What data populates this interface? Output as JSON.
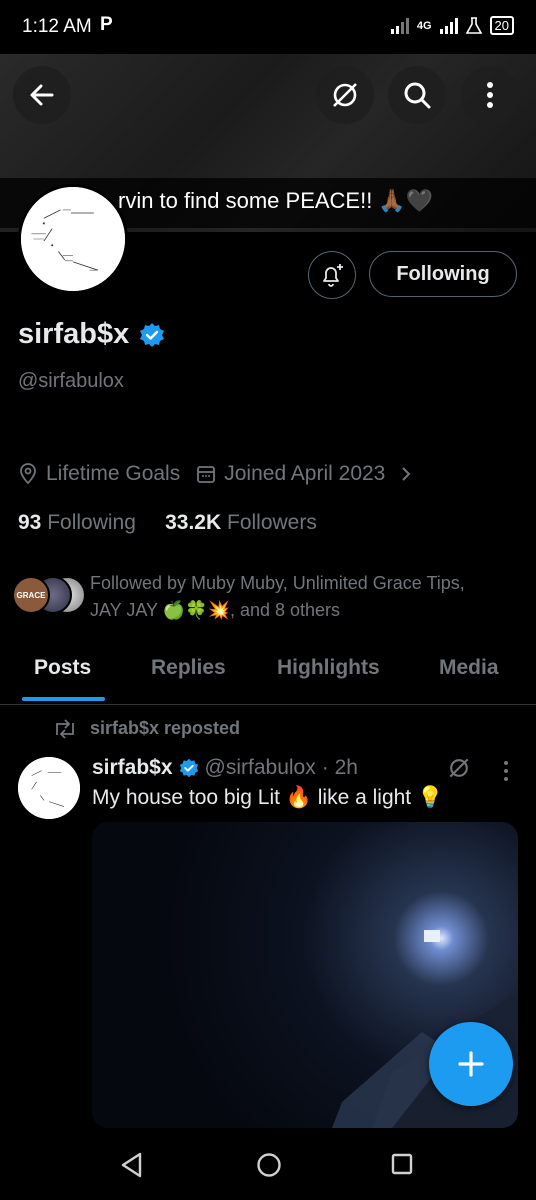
{
  "status_bar": {
    "time": "1:12 AM",
    "carrier_icon": "P",
    "network": "4G",
    "battery": "20"
  },
  "banner": {
    "caption": "rvin to find some PEACE!! 🙏🏾🖤"
  },
  "profile": {
    "following_button": "Following",
    "display_name": "sirfab$x",
    "handle": "@sirfabulox",
    "location": "Lifetime Goals",
    "joined": "Joined April 2023",
    "following_count": "93",
    "following_label": "Following",
    "followers_count": "33.2K",
    "followers_label": "Followers",
    "followed_by_line1": "Followed by Muby Muby, Unlimited Grace Tips,",
    "followed_by_line2": "JAY JAY 🍏🍀💥, and 8 others",
    "mini_avatar_text": "GRACE"
  },
  "tabs": [
    "Posts",
    "Replies",
    "Highlights",
    "Media"
  ],
  "post": {
    "repost_label": "sirfab$x reposted",
    "author_name": "sirfab$x",
    "author_handle": "@sirfabulox",
    "time": "· 2h",
    "text": "My house too big Lit 🔥 like a light 💡"
  },
  "colors": {
    "accent": "#1d9bf0",
    "text_primary": "#e7e9ea",
    "text_secondary": "#71767b",
    "background": "#000000"
  },
  "icons": {
    "back": "arrow-left-icon",
    "grok": "grok-icon",
    "search": "search-icon",
    "more": "more-vertical-icon",
    "notify": "bell-plus-icon",
    "verified": "verified-badge-icon",
    "location": "location-pin-icon",
    "calendar": "calendar-icon",
    "repost": "repost-icon",
    "compose": "plus-icon"
  }
}
